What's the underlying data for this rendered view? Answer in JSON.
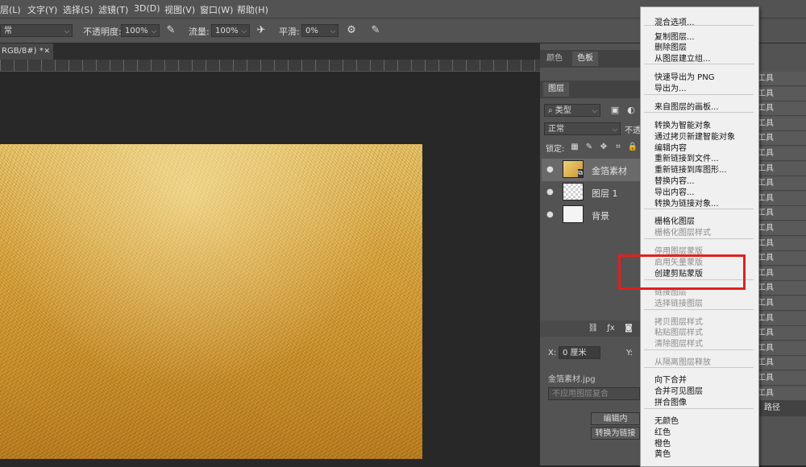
{
  "menubar": {
    "items": [
      "层(L)",
      "文字(Y)",
      "选择(S)",
      "滤镜(T)",
      "3D(D)",
      "视图(V)",
      "窗口(W)",
      "帮助(H)"
    ]
  },
  "options": {
    "mode_value": "常",
    "opacity_label": "不透明度:",
    "opacity_value": "100%",
    "flow_label": "流量:",
    "flow_value": "100%",
    "smooth_label": "平滑:",
    "smooth_value": "0%"
  },
  "document": {
    "tab_label": "RGB/8#) *",
    "close_glyph": "✕"
  },
  "panels": {
    "top_tabs": [
      "颜色",
      "色板"
    ],
    "layers_tab": "图层",
    "filter_kind": "类型",
    "blend_mode": "正常",
    "opacity_short": "不透",
    "lock_label": "锁定:",
    "layers": [
      {
        "name": "金箔素材"
      },
      {
        "name": "图层 1"
      },
      {
        "name": "背景"
      }
    ],
    "props_x_label": "X:",
    "props_x_value": "0 厘米",
    "props_y_label": "Y:",
    "file_name": "金箔素材.jpg",
    "comp_placeholder": "不应用图层复合",
    "edit_btn": "编辑内",
    "convert_btn": "转换为链接",
    "path_tab": "路径",
    "right_strip": [
      "工具",
      "工具",
      "工具",
      "工具",
      "工具",
      "工具",
      "工具",
      "工具",
      "工具",
      "工具",
      "工具",
      "工具",
      "工具",
      "工具",
      "工具",
      "工具",
      "工具",
      "工具",
      "工具",
      "工具",
      "工具",
      "工具",
      "工具"
    ]
  },
  "context_menu": {
    "items": [
      {
        "label": "混合选项...",
        "disabled": false
      },
      {
        "label": "复制图层...",
        "disabled": false
      },
      {
        "label": "删除图层",
        "disabled": false
      },
      {
        "label": "从图层建立组...",
        "disabled": false
      },
      {
        "label": "快速导出为 PNG",
        "disabled": false
      },
      {
        "label": "导出为...",
        "disabled": false
      },
      {
        "label": "来自图层的画板...",
        "disabled": false
      },
      {
        "label": "转换为智能对象",
        "disabled": false
      },
      {
        "label": "通过拷贝新建智能对象",
        "disabled": false
      },
      {
        "label": "编辑内容",
        "disabled": false
      },
      {
        "label": "重新链接到文件...",
        "disabled": false
      },
      {
        "label": "重新链接到库图形...",
        "disabled": false
      },
      {
        "label": "替换内容...",
        "disabled": false
      },
      {
        "label": "导出内容...",
        "disabled": false
      },
      {
        "label": "转换为链接对象...",
        "disabled": false
      },
      {
        "label": "栅格化图层",
        "disabled": false
      },
      {
        "label": "栅格化图层样式",
        "disabled": true
      },
      {
        "label": "停用图层蒙版",
        "disabled": true
      },
      {
        "label": "启用矢量蒙版",
        "disabled": true
      },
      {
        "label": "创建剪贴蒙版",
        "disabled": false
      },
      {
        "label": "链接图层",
        "disabled": true
      },
      {
        "label": "选择链接图层",
        "disabled": true
      },
      {
        "label": "拷贝图层样式",
        "disabled": true
      },
      {
        "label": "粘贴图层样式",
        "disabled": true
      },
      {
        "label": "清除图层样式",
        "disabled": true
      },
      {
        "label": "从隔离图层释放",
        "disabled": true
      },
      {
        "label": "向下合并",
        "disabled": false
      },
      {
        "label": "合并可见图层",
        "disabled": false
      },
      {
        "label": "拼合图像",
        "disabled": false
      },
      {
        "label": "无颜色",
        "disabled": false
      },
      {
        "label": "红色",
        "disabled": false
      },
      {
        "label": "橙色",
        "disabled": false
      },
      {
        "label": "黄色",
        "disabled": false
      }
    ]
  },
  "colors": {
    "highlight": "#e02020",
    "menu_bg": "#f0f0f0",
    "panel_bg": "#535353"
  }
}
